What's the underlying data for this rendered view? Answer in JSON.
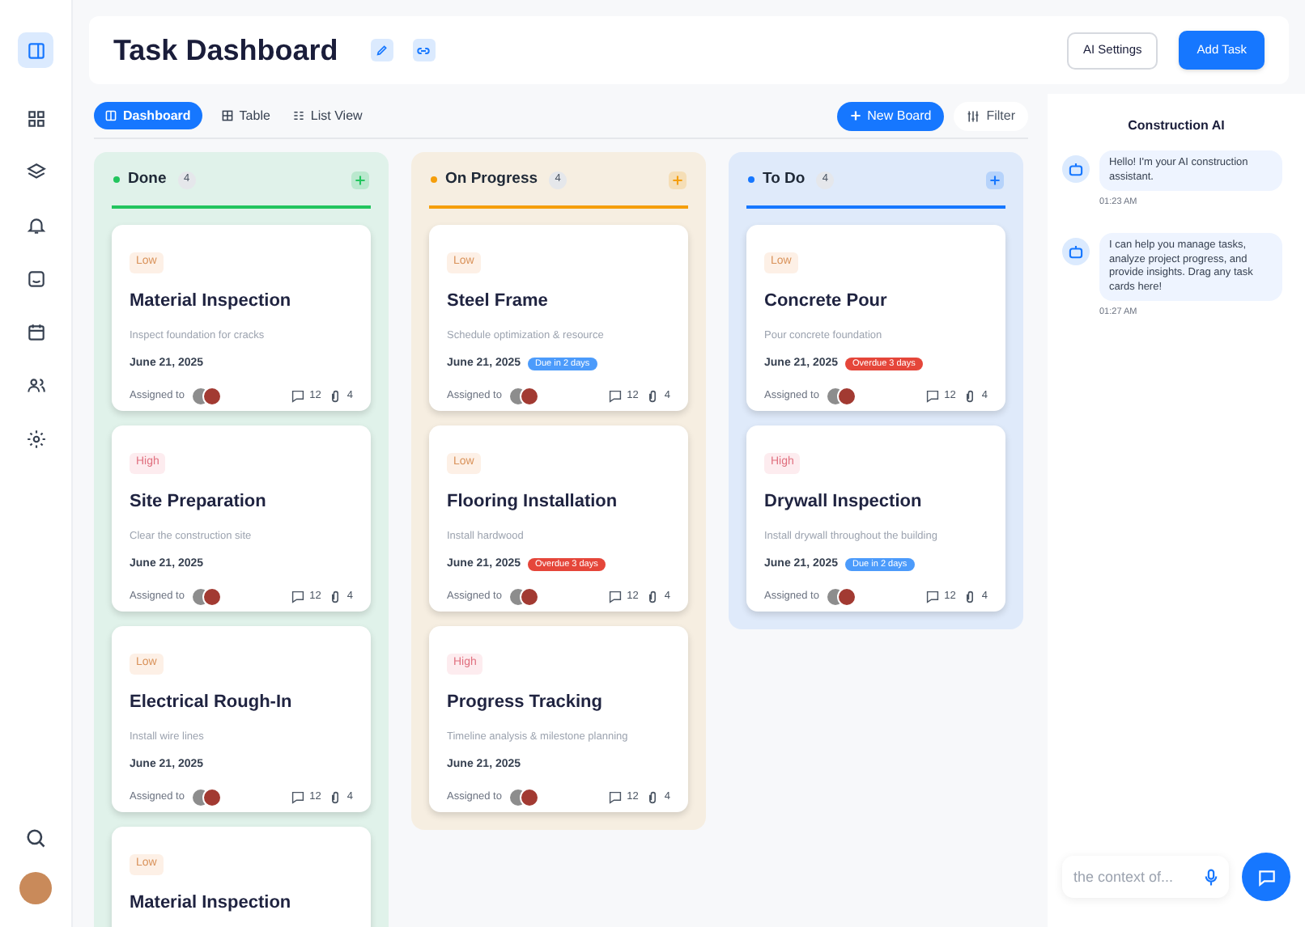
{
  "sidebar": {
    "items": [
      {
        "selected": true
      },
      {
        "selected": false
      },
      {
        "selected": false
      },
      {
        "selected": false
      },
      {
        "selected": false
      },
      {
        "selected": false
      },
      {
        "selected": false
      },
      {
        "selected": false
      }
    ]
  },
  "header": {
    "title": "Task Dashboard",
    "buttons": [
      "AI Settings",
      "Add Task"
    ]
  },
  "views": [
    {
      "label": "Dashboard",
      "selected": true
    },
    {
      "label": "Table",
      "selected": false
    },
    {
      "label": "List View",
      "selected": false
    }
  ],
  "toolbar": {
    "new_board": "New Board",
    "filter": "Filter"
  },
  "columns": [
    {
      "name": "Done",
      "count": "4",
      "color": "#22c55e",
      "cards": [
        {
          "priority": {
            "label": "Low",
            "kind": "low"
          },
          "title": "Material Inspection",
          "description": "Inspect foundation for cracks",
          "date": "June 21, 2025",
          "assigned": "Assigned to",
          "comments": "12",
          "attachments": "4"
        },
        {
          "priority": {
            "label": "High",
            "kind": "high"
          },
          "title": "Site Preparation",
          "description": "Clear the construction site",
          "date": "June 21, 2025",
          "assigned": "Assigned to",
          "comments": "12",
          "attachments": "4"
        },
        {
          "priority": {
            "label": "Low",
            "kind": "low"
          },
          "title": "Electrical Rough-In",
          "description": "Install wire lines",
          "date": "June 21, 2025",
          "assigned": "Assigned to",
          "comments": "12",
          "attachments": "4"
        },
        {
          "priority": {
            "label": "Low",
            "kind": "low"
          },
          "title": "Material Inspection"
        }
      ]
    },
    {
      "name": "On Progress",
      "count": "4",
      "color": "#f59e0b",
      "cards": [
        {
          "priority": {
            "label": "Low",
            "kind": "low"
          },
          "title": "Steel Frame",
          "description": "Schedule optimization & resource",
          "date": "June 21, 2025",
          "due": {
            "label": "Due in 2 days",
            "kind": "due"
          },
          "assigned": "Assigned to",
          "comments": "12",
          "attachments": "4"
        },
        {
          "priority": {
            "label": "Low",
            "kind": "low"
          },
          "title": "Flooring Installation",
          "description": "Install hardwood",
          "date": "June 21, 2025",
          "due": {
            "label": "Overdue 3 days",
            "kind": "overdue"
          },
          "assigned": "Assigned to",
          "comments": "12",
          "attachments": "4"
        },
        {
          "priority": {
            "label": "High",
            "kind": "high"
          },
          "title": "Progress Tracking",
          "description": "Timeline analysis & milestone planning",
          "date": "June 21, 2025",
          "assigned": "Assigned to",
          "comments": "12",
          "attachments": "4"
        }
      ]
    },
    {
      "name": "To Do",
      "count": "4",
      "color": "#1677ff",
      "cards": [
        {
          "priority": {
            "label": "Low",
            "kind": "low"
          },
          "title": "Concrete Pour",
          "description": "Pour concrete foundation",
          "date": "June 21, 2025",
          "due": {
            "label": "Overdue 3 days",
            "kind": "overdue"
          },
          "assigned": "Assigned to",
          "comments": "12",
          "attachments": "4"
        },
        {
          "priority": {
            "label": "High",
            "kind": "high"
          },
          "title": "Drywall Inspection",
          "description": "Install drywall throughout the building",
          "date": "June 21, 2025",
          "due": {
            "label": "Due in 2 days",
            "kind": "due"
          },
          "assigned": "Assigned to",
          "comments": "12",
          "attachments": "4"
        }
      ]
    }
  ],
  "chat": {
    "title": "Construction AI",
    "messages": [
      {
        "text": "Hello! I'm your AI construction assistant.",
        "time": "01:23 AM"
      },
      {
        "text": "I can help you manage tasks, analyze project progress, and provide insights. Drag any task cards here!",
        "time": "01:27 AM"
      }
    ],
    "input": {
      "placeholder": "the context of..."
    }
  }
}
